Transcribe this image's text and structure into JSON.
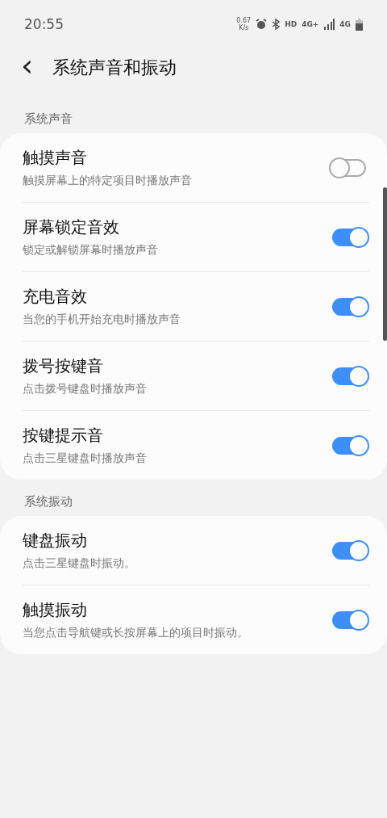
{
  "status_bar": {
    "time": "20:55",
    "speed_value": "0.67",
    "speed_unit": "K/s",
    "hd": "HD",
    "network": "4G+",
    "network_2": "4G"
  },
  "header": {
    "back": "‹",
    "title": "系统声音和振动"
  },
  "sections": [
    {
      "title": "系统声音",
      "items": [
        {
          "title": "触摸声音",
          "subtitle": "触摸屏幕上的特定项目时播放声音",
          "on": false
        },
        {
          "title": "屏幕锁定音效",
          "subtitle": "锁定或解锁屏幕时播放声音",
          "on": true
        },
        {
          "title": "充电音效",
          "subtitle": "当您的手机开始充电时播放声音",
          "on": true
        },
        {
          "title": "拨号按键音",
          "subtitle": "点击拨号键盘时播放声音",
          "on": true
        },
        {
          "title": "按键提示音",
          "subtitle": "点击三星键盘时播放声音",
          "on": true
        }
      ]
    },
    {
      "title": "系统振动",
      "items": [
        {
          "title": "键盘振动",
          "subtitle": "点击三星键盘时振动。",
          "on": true
        },
        {
          "title": "触摸振动",
          "subtitle": "当您点击导航键或长按屏幕上的项目时振动。",
          "on": true
        }
      ]
    }
  ]
}
